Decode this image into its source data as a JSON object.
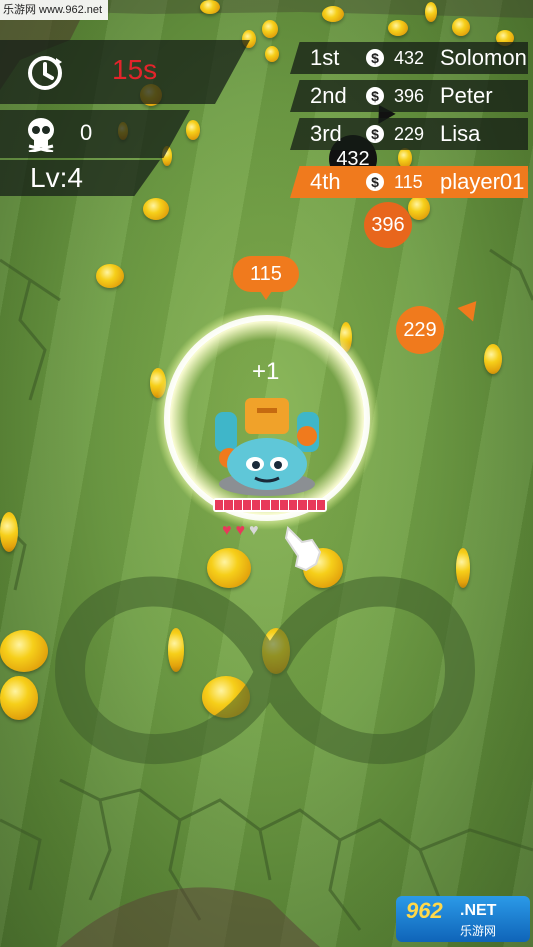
{
  "watermark_top": "乐游网 www.962.net",
  "watermark_bottom": {
    "big": "962",
    "net": ".NET",
    "cn": "乐游网"
  },
  "hud": {
    "timer_icon": "clock-icon",
    "timer": "15s",
    "kills_icon": "skull-icon",
    "kills": "0",
    "level": "Lv:4"
  },
  "leaderboard": [
    {
      "rank": "1st",
      "coin": "$",
      "score": "432",
      "name": "Solomon"
    },
    {
      "rank": "2nd",
      "coin": "$",
      "score": "396",
      "name": "Peter"
    },
    {
      "rank": "3rd",
      "coin": "$",
      "score": "229",
      "name": "Lisa"
    },
    {
      "rank": "4th",
      "coin": "$",
      "score": "115",
      "name": "player01"
    }
  ],
  "enemies": [
    {
      "score": "432",
      "color": "#111111"
    },
    {
      "score": "396",
      "color": "#e8661c"
    },
    {
      "score": "229",
      "color": "#f07a1d"
    }
  ],
  "player": {
    "score_tag": "115",
    "pickup": "+1",
    "health_fraction": 1.0,
    "hearts": [
      "heart-full",
      "heart-full",
      "heart-empty"
    ],
    "accent": "#f07a1d"
  },
  "joystick_icon": "infinity-path-icon",
  "cursor_icon": "pointer-hand-icon"
}
